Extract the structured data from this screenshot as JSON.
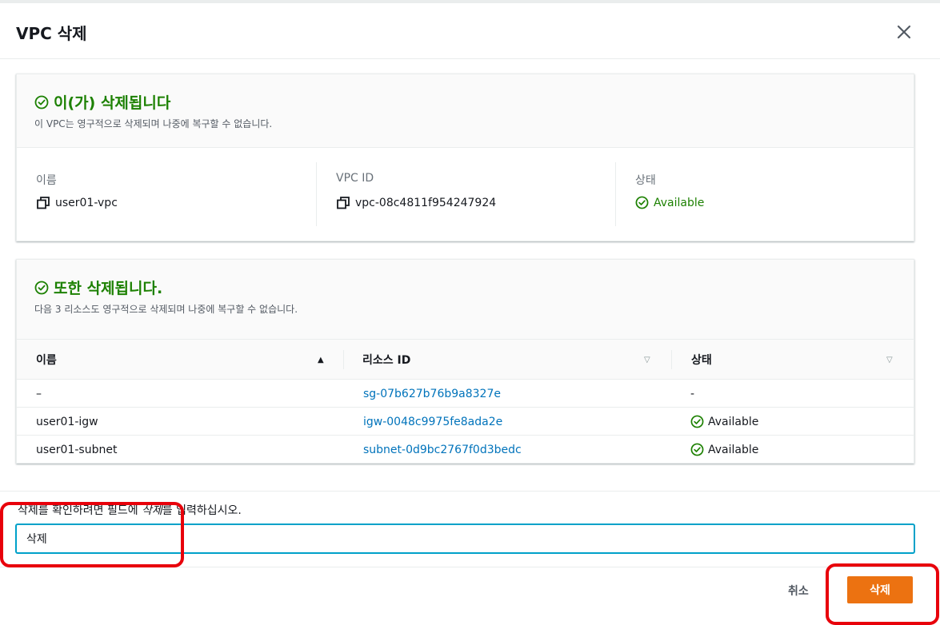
{
  "modal": {
    "title": "VPC 삭제"
  },
  "primary": {
    "title": "이(가) 삭제됩니다",
    "description": "이 VPC는 영구적으로 삭제되며 나중에 복구할 수 없습니다.",
    "fields": [
      {
        "label": "이름",
        "value": "user01-vpc"
      },
      {
        "label": "VPC ID",
        "value": "vpc-08c4811f954247924"
      },
      {
        "label": "상태",
        "value": "Available"
      }
    ]
  },
  "related": {
    "title": "또한 삭제됩니다.",
    "description": "다음 3 리소스도 영구적으로 삭제되며 나중에 복구할 수 없습니다.",
    "columns": [
      "이름",
      "리소스 ID",
      "상태"
    ],
    "rows": [
      {
        "name": "–",
        "id": "sg-07b627b76b9a8327e",
        "status": "-"
      },
      {
        "name": "user01-igw",
        "id": "igw-0048c9975fe8ada2e",
        "status": "Available"
      },
      {
        "name": "user01-subnet",
        "id": "subnet-0d9bc2767f0d3bedc",
        "status": "Available"
      }
    ]
  },
  "confirm": {
    "label_prefix": "삭제를 확인하려면 필드에 ",
    "label_keyword": "삭제",
    "label_suffix": "를 입력하십시오.",
    "input_value": "삭제"
  },
  "footer": {
    "cancel_label": "취소",
    "delete_label": "삭제"
  },
  "colors": {
    "success": "#1d8102",
    "link": "#0073bb",
    "primary_button": "#ec7211",
    "focus": "#00a1c9",
    "callout": "#e8000b"
  }
}
